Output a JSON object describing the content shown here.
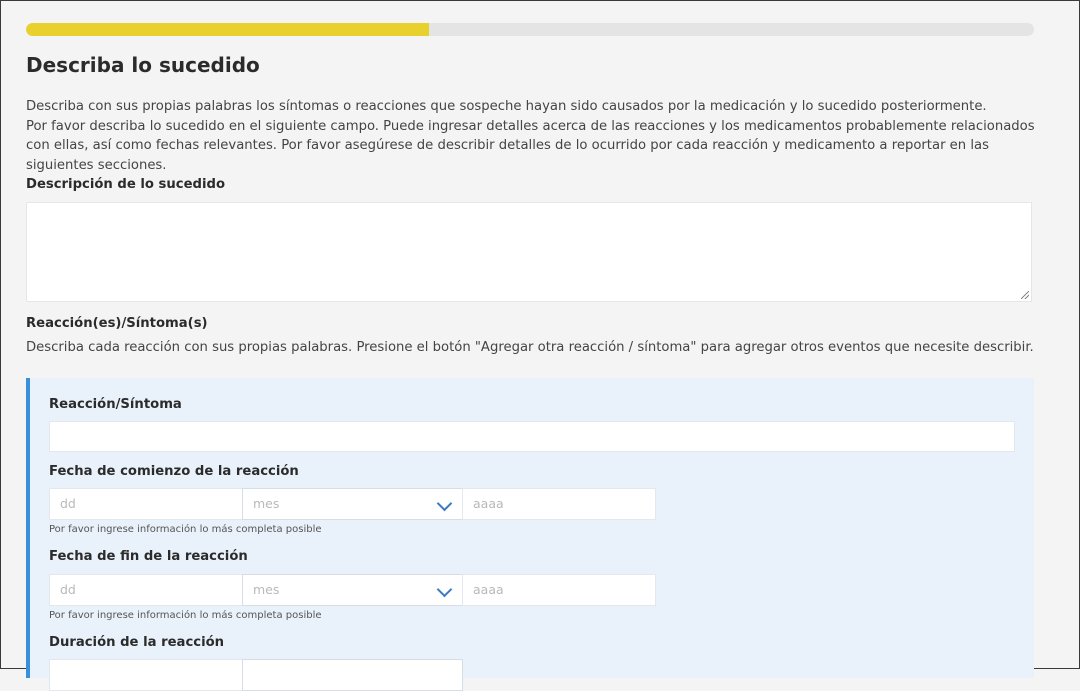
{
  "progress": {
    "fraction": 0.4
  },
  "page": {
    "title": "Describa lo sucedido",
    "intro_line1": "Describa con sus propias palabras los síntomas o reacciones que sospeche hayan sido causados por la medicación y lo sucedido posteriormente.",
    "intro_line2": "Por favor describa lo sucedido en el siguiente campo. Puede ingresar detalles acerca de las reacciones y los medicamentos probablemente relacionados con ellas, así como fechas relevantes. Por favor asegúrese de describir detalles de lo ocurrido por cada reacción y medicamento a reportar en las siguientes secciones."
  },
  "description": {
    "label": "Descripción de lo sucedido",
    "value": ""
  },
  "reactions": {
    "label": "Reacción(es)/Síntoma(s)",
    "help": "Describa cada reacción con sus propias palabras. Presione el botón \"Agregar otra reacción / síntoma\" para agregar otros eventos que necesite describir."
  },
  "reaction_panel": {
    "reaction_label": "Reacción/Síntoma",
    "reaction_value": "",
    "start_label": "Fecha de comienzo de la reacción",
    "end_label": "Fecha de fin de la reacción",
    "duration_label": "Duración de la reacción",
    "day_placeholder": "dd",
    "month_placeholder": "mes",
    "year_placeholder": "aaaa",
    "date_note": "Por favor ingrese información lo más completa posible"
  },
  "colors": {
    "progress_fill": "#e8d12d",
    "panel_accent": "#3a8fd9",
    "chevron": "#3a7bbf"
  },
  "icons": {
    "select_arrow": "chevron-down-icon",
    "resize": "resize-handle-icon"
  }
}
